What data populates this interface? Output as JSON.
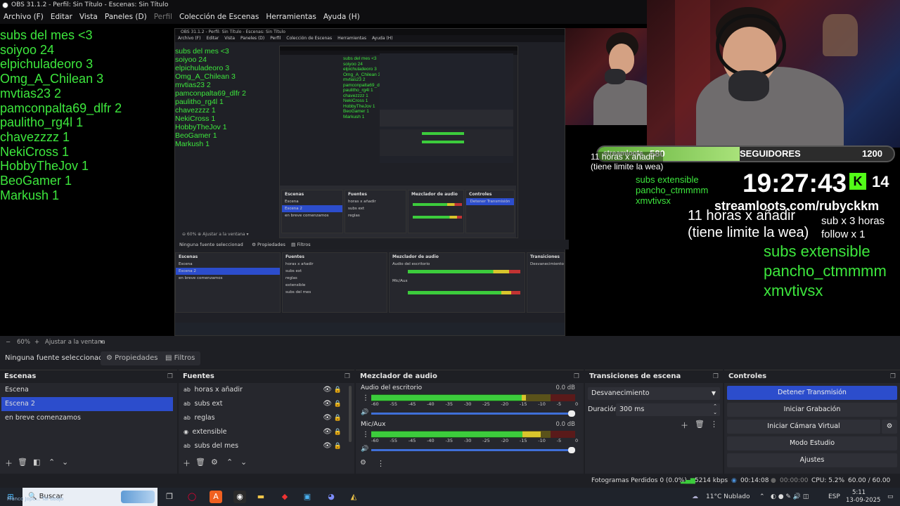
{
  "window": {
    "title": "OBS 31.1.2 - Perfil: Sin Título - Escenas: Sin Título"
  },
  "menu": {
    "archivo": "Archivo (F)",
    "editar": "Editar",
    "vista": "Vista",
    "paneles": "Paneles (D)",
    "perfil": "Perfil",
    "coleccion": "Colección de Escenas",
    "herramientas": "Herramientas",
    "ayuda": "Ayuda (H)"
  },
  "overlay": {
    "subs_list": [
      "subs del mes <3",
      "soiyoo 24",
      "elpichuladeoro 3",
      "Omg_A_Chilean 3",
      "mvtias23 2",
      "pamconpalta69_dlfr 2",
      "paulitho_rg4l 1",
      "chavezzzz 1",
      "NekiCross 1",
      "HobbyTheJov 1",
      "BeoGamer 1",
      "Markush 1"
    ],
    "streamloots": "streamloots",
    "followers_current": "580",
    "followers_label": "SEGUIDORES",
    "followers_goal": "1200",
    "followers_progress": 0.48,
    "clock": "19:27:43",
    "kick_count": "14",
    "streamloots_url": "streamloots.com/rubyckkm",
    "note_line1": "11 horas x añadir",
    "note_line2": "(tiene limite la wea)",
    "rule_line1": "sub x 3 horas",
    "rule_line2": "follow x 1",
    "green_lines": [
      "subs extensible",
      "pancho_ctmmmm",
      "xmvtivsx"
    ]
  },
  "toolbar": {
    "zoom": "60%",
    "zoom_minus": "−",
    "zoom_plus": "+",
    "fit": "Ajustar a la ventana",
    "fit_chevron": "▾"
  },
  "props": {
    "no_source": "Ninguna fuente seleccionad",
    "properties": "Propiedades",
    "filters": "Filtros"
  },
  "scenes": {
    "title": "Escenas",
    "items": [
      "Escena",
      "Escena 2",
      "en breve comenzamos"
    ],
    "selected": 1
  },
  "sources": {
    "title": "Fuentes",
    "items": [
      {
        "name": "horas x añadir",
        "icon": "ab"
      },
      {
        "name": "subs ext",
        "icon": "ab"
      },
      {
        "name": "reglas",
        "icon": "ab"
      },
      {
        "name": "extensible",
        "icon": "globe"
      },
      {
        "name": "subs del mes",
        "icon": "ab"
      }
    ]
  },
  "mixer": {
    "title": "Mezclador de audio",
    "channels": [
      {
        "name": "Audio del escritorio",
        "db": "0.0 dB",
        "level": 0.76
      },
      {
        "name": "Mic/Aux",
        "db": "0.0 dB",
        "level": 0.83
      }
    ],
    "ticks": [
      "-60",
      "-55",
      "-45",
      "-40",
      "-35",
      "-30",
      "-25",
      "-20",
      "-15",
      "-10",
      "-5",
      "0"
    ]
  },
  "transitions": {
    "title": "Transiciones de escena",
    "type": "Desvanecimiento",
    "duration_label": "Duración",
    "duration": "300 ms"
  },
  "controls": {
    "title": "Controles",
    "stop_stream": "Detener Transmisión",
    "start_record": "Iniciar Grabación",
    "virtual_cam": "Iniciar Cámara Virtual",
    "studio": "Modo Estudio",
    "settings": "Ajustes"
  },
  "status": {
    "dropped": "Fotogramas Perdidos 0 (0.0%)",
    "kbps": "5214 kbps",
    "stream_time": "00:14:08",
    "record_time": "00:00:00",
    "cpu": "CPU: 5.2%",
    "fps": "60.00 / 60.00 FPS"
  },
  "taskbar": {
    "search": "Buscar",
    "weather": "11°C  Nublado",
    "lang": "ESP",
    "time": "5:11",
    "date": "13-09-2025",
    "tray_note1": "Franco Jope...",
    "tray_note2": "Tal abajo"
  },
  "colors": {
    "accent": "#2c4dcc",
    "green_text": "#3de73d",
    "meter_green": "#3ccc3c",
    "meter_yellow": "#d8c52c",
    "meter_red": "#c23333"
  }
}
